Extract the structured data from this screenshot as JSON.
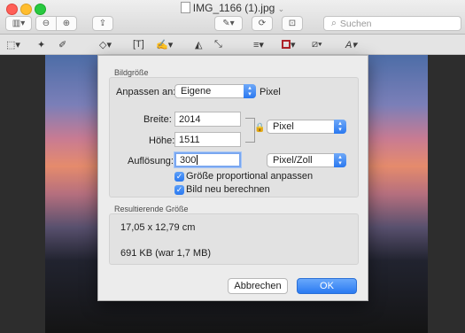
{
  "window": {
    "title": "IMG_1166 (1).jpg"
  },
  "toolbar": {
    "search_placeholder": "Suchen",
    "buttons": [
      "sidebar-icon",
      "zoom-out-icon",
      "zoom-in-icon",
      "share-icon",
      "pen-icon",
      "rotate-icon",
      "toolbox-icon"
    ]
  },
  "markup": {
    "tools": [
      "selection-icon",
      "instant-alpha-icon",
      "sketch-icon",
      "shapes-icon",
      "text-icon",
      "sign-icon",
      "adjust-color-icon",
      "adjust-size-icon",
      "shape-style-icon",
      "border-color-icon",
      "fill-color-icon",
      "text-style-icon"
    ]
  },
  "dialog": {
    "bildgroesse_title": "Bildgröße",
    "anpassen_label": "Anpassen an:",
    "anpassen_value": "Eigene",
    "pixel_label": "Pixel",
    "breite_label": "Breite:",
    "breite_value": "2014",
    "hoehe_label": "Höhe:",
    "hoehe_value": "1511",
    "unit_value": "Pixel",
    "aufloesung_label": "Auflösung:",
    "aufloesung_value": "300",
    "resolution_unit_value": "Pixel/Zoll",
    "proportional_label": "Größe proportional anpassen",
    "proportional_checked": true,
    "resample_label": "Bild neu berechnen",
    "resample_checked": true,
    "result_title": "Resultierende Größe",
    "result_dimensions": "17,05 x 12,79 cm",
    "result_filesize": "691 KB (war 1,7 MB)",
    "cancel_label": "Abbrechen",
    "ok_label": "OK"
  }
}
